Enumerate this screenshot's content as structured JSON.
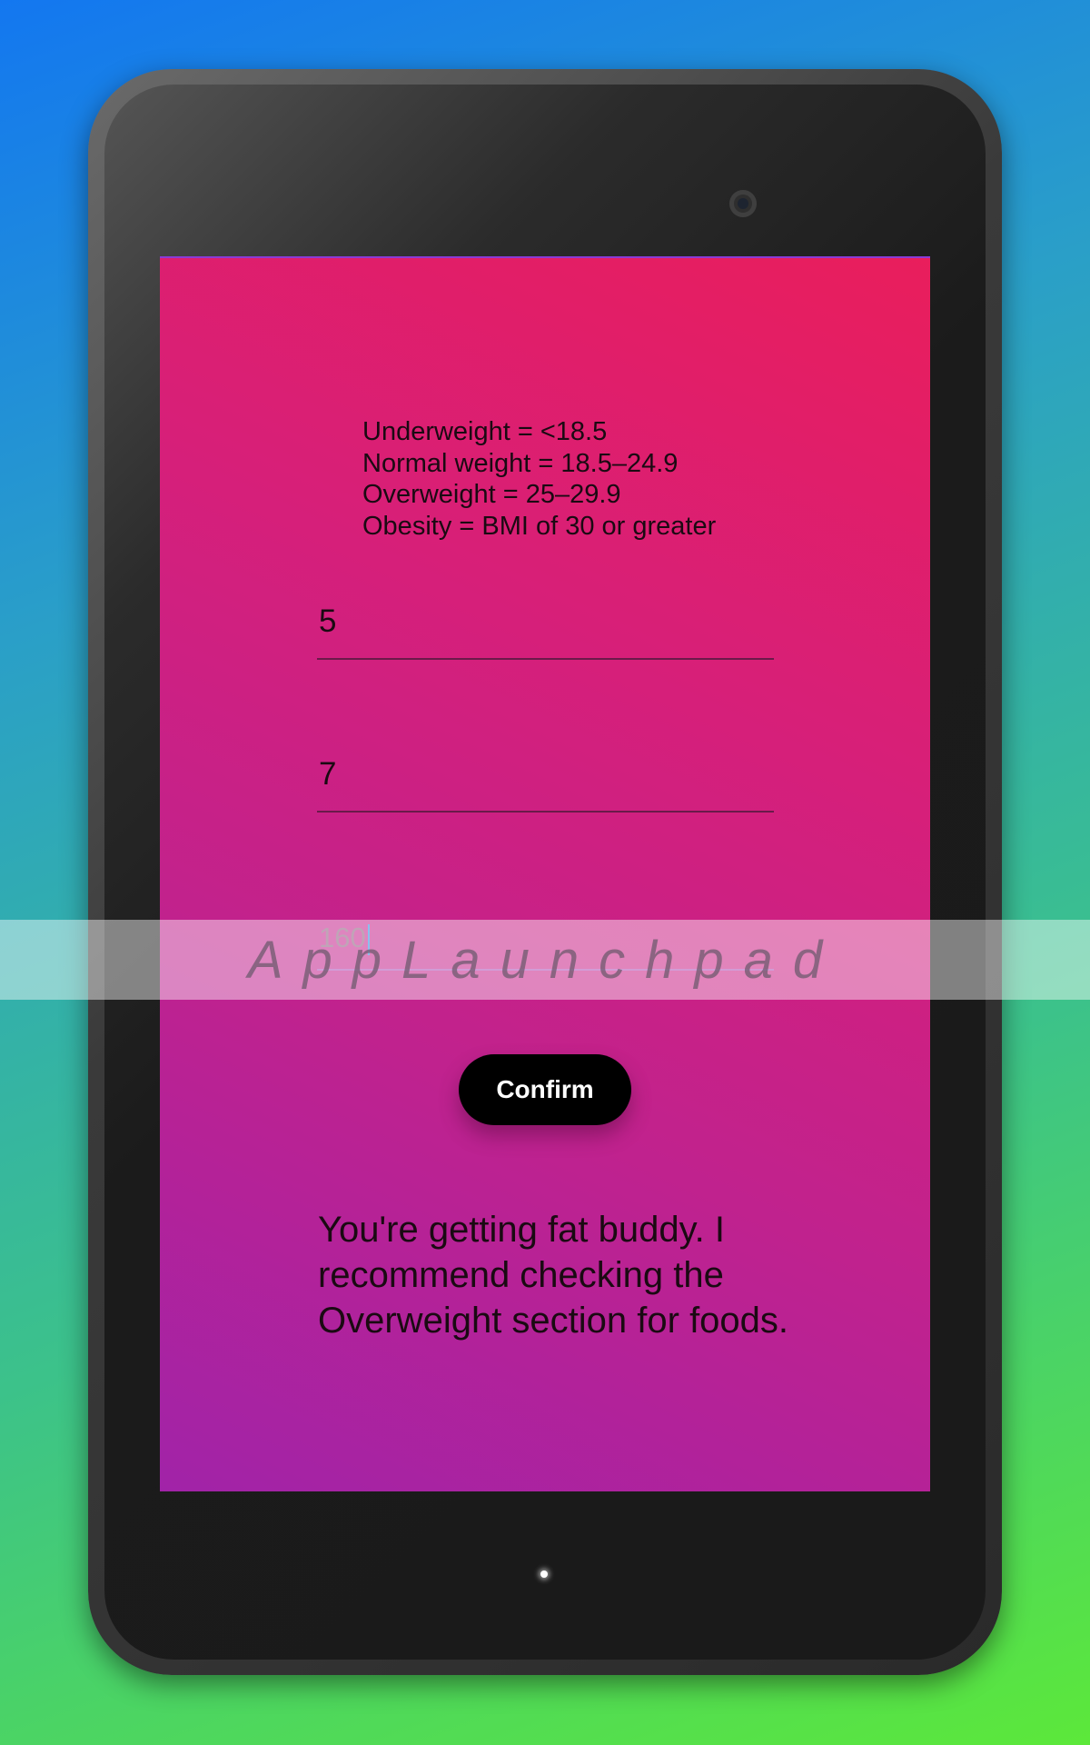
{
  "bmi_ranges": [
    "Underweight = <18.5",
    "Normal weight = 18.5–24.9",
    "Overweight = 25–29.9",
    "Obesity = BMI of 30 or greater"
  ],
  "inputs": {
    "feet": "5",
    "inches": "7",
    "weight": "160"
  },
  "confirm_label": "Confirm",
  "result_text": "You're getting fat buddy. I recommend checking the Overweight section for foods.",
  "watermark": "AppLaunchpad"
}
